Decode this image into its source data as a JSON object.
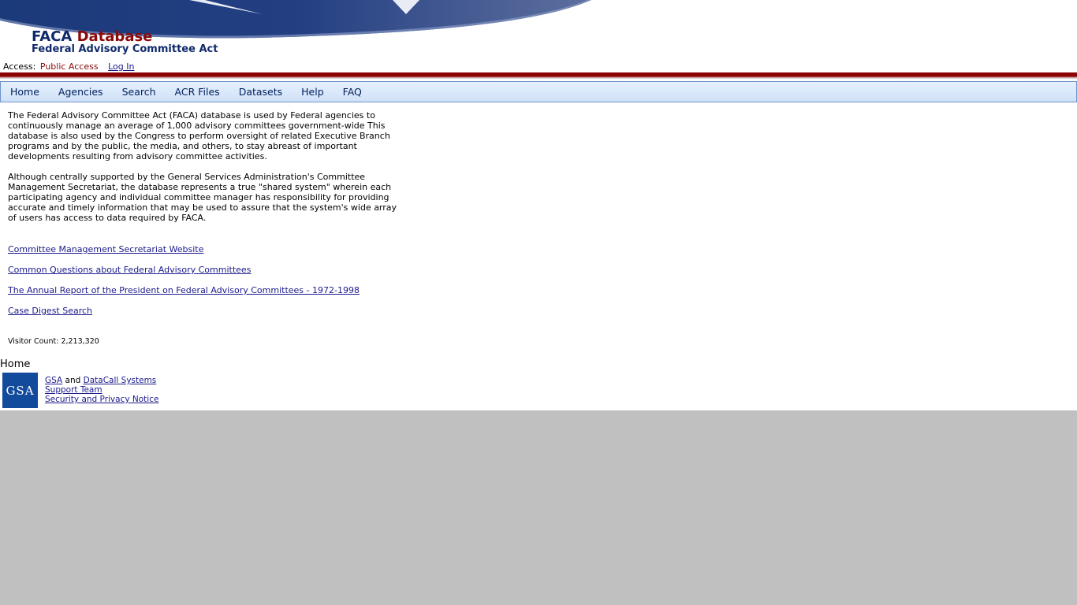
{
  "header": {
    "title_part1": "FACA",
    "title_part2": "Database",
    "subtitle": "Federal Advisory Committee Act"
  },
  "access": {
    "label": "Access:",
    "value": "Public Access",
    "login_link": "Log In"
  },
  "nav": {
    "items": [
      "Home",
      "Agencies",
      "Search",
      "ACR Files",
      "Datasets",
      "Help",
      "FAQ"
    ]
  },
  "content": {
    "paragraph1": "The Federal Advisory Committee Act (FACA) database is used by Federal agencies to continuously manage an average of 1,000 advisory committees government-wide This database is also used by the Congress to perform oversight of related Executive Branch programs and by the public, the media, and others, to stay abreast of important developments resulting from advisory committee activities.",
    "paragraph2": "Although centrally supported by the General Services Administration's Committee Management Secretariat, the database represents a true \"shared system\" wherein each participating agency and individual committee manager has responsibility for providing accurate and timely information that may be used to assure that the system's wide array of users has access to data required by FACA.",
    "links": [
      "Committee Management Secretariat Website",
      "Common Questions about Federal Advisory Committees",
      "The Annual Report of the President on Federal Advisory Committees - 1972-1998",
      "Case Digest Search"
    ],
    "visitor_count_label": "Visitor Count:",
    "visitor_count_value": "2,213,320"
  },
  "footer": {
    "home_label": "Home",
    "logo_text": "GSA",
    "link_gsa": "GSA",
    "and_text": "and",
    "link_datacall": "DataCall Systems",
    "link_support": "Support Team",
    "link_privacy": "Security and Privacy Notice"
  },
  "colors": {
    "brand_navy": "#0f2a6b",
    "brand_red": "#8b0a0a",
    "link": "#1a1a8c",
    "nav_bg": "#cfe1f8",
    "gsa_blue": "#124b9b",
    "outside_bg": "#c0c0c0"
  }
}
